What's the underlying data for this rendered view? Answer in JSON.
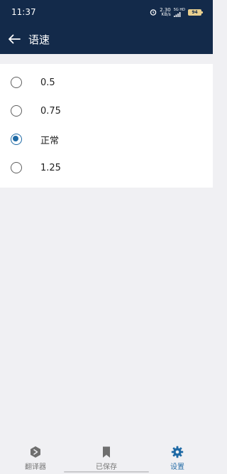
{
  "status_bar": {
    "time": "11:37",
    "speed_value": "2.30",
    "speed_unit": "KB/s",
    "network_top": "5G HD",
    "network_bottom": "5G",
    "battery": "94"
  },
  "app_bar": {
    "title": "语速",
    "back_icon": "arrow-left-icon"
  },
  "speech_rate": {
    "options": [
      {
        "label": "0.5",
        "selected": false
      },
      {
        "label": "0.75",
        "selected": false
      },
      {
        "label": "正常",
        "selected": true
      },
      {
        "label": "1.25",
        "selected": false
      }
    ]
  },
  "bottom_nav": {
    "items": [
      {
        "label": "翻译器",
        "icon": "translator-icon",
        "active": false
      },
      {
        "label": "已保存",
        "icon": "bookmark-icon",
        "active": false
      },
      {
        "label": "设置",
        "icon": "gear-icon",
        "active": true
      }
    ]
  },
  "colors": {
    "header_bg": "#132a4a",
    "accent": "#1f6aa5",
    "background": "#f0f0f3"
  }
}
